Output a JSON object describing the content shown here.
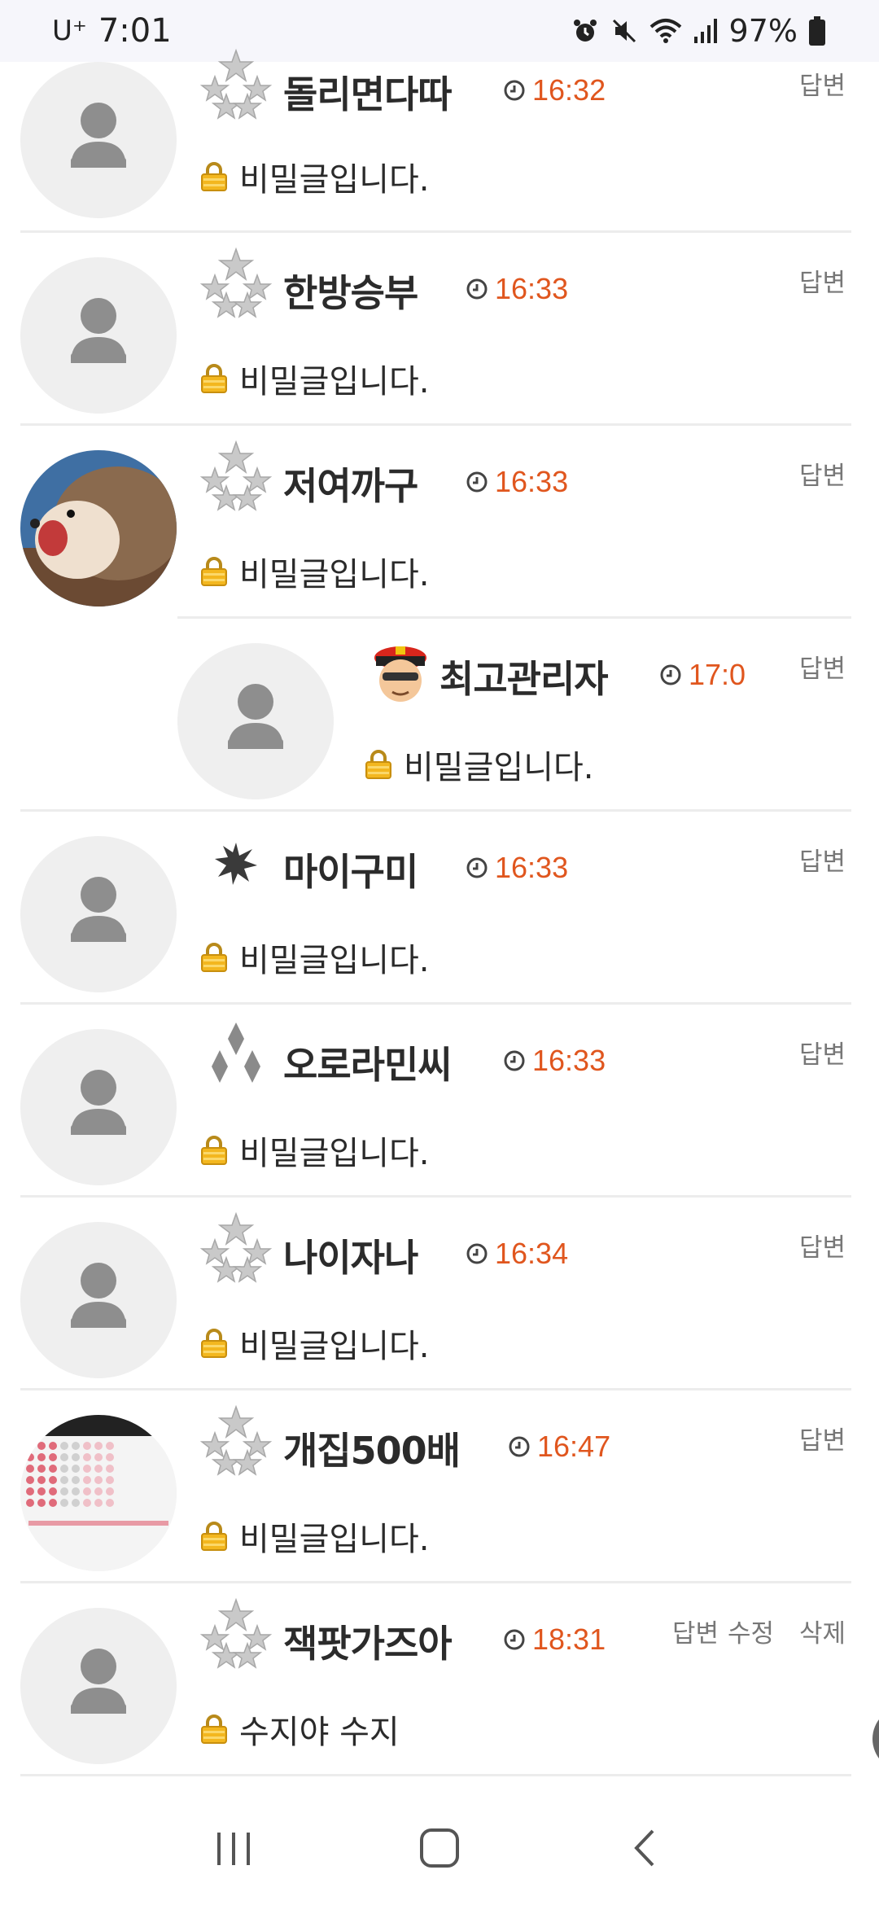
{
  "status": {
    "carrier": "U⁺",
    "time": "7:01",
    "battery": "97%"
  },
  "comments": [
    {
      "nickname": "돌리면다따",
      "time": "16:32",
      "body": "비밀글입니다.",
      "reply": "답변",
      "level_icon": "stars-icon",
      "avatar": "default-person"
    },
    {
      "nickname": "한방승부",
      "time": "16:33",
      "body": "비밀글입니다.",
      "reply": "답변",
      "level_icon": "stars-icon",
      "avatar": "default-person"
    },
    {
      "nickname": "저여까구",
      "time": "16:33",
      "body": "비밀글입니다.",
      "reply": "답변",
      "level_icon": "stars-icon",
      "avatar": "hedgehog-photo"
    },
    {
      "nickname": "최고관리자",
      "time": "17:0",
      "body": "비밀글입니다.",
      "reply": "답변",
      "level_icon": "admin-officer-icon",
      "avatar": "default-person"
    },
    {
      "nickname": "마이구미",
      "time": "16:33",
      "body": "비밀글입니다.",
      "reply": "답변",
      "level_icon": "starburst-icon",
      "avatar": "default-person"
    },
    {
      "nickname": "오로라민씨",
      "time": "16:33",
      "body": "비밀글입니다.",
      "reply": "답변",
      "level_icon": "diamonds-icon",
      "avatar": "default-person"
    },
    {
      "nickname": "나이자나",
      "time": "16:34",
      "body": "비밀글입니다.",
      "reply": "답변",
      "level_icon": "stars-icon",
      "avatar": "default-person"
    },
    {
      "nickname": "개집500배",
      "time": "16:47",
      "body": "비밀글입니다.",
      "reply": "답변",
      "level_icon": "stars-icon",
      "avatar": "grid-photo"
    },
    {
      "nickname": "잭팟가즈아",
      "time": "18:31",
      "body": "수지야 수지",
      "reply": "답변",
      "edit": "수정",
      "delete": "삭제",
      "level_icon": "stars-icon",
      "avatar": "default-person"
    }
  ],
  "colors": {
    "accent_time": "#e0561e",
    "divider": "#ececec",
    "avatar_bg": "#efefef"
  }
}
